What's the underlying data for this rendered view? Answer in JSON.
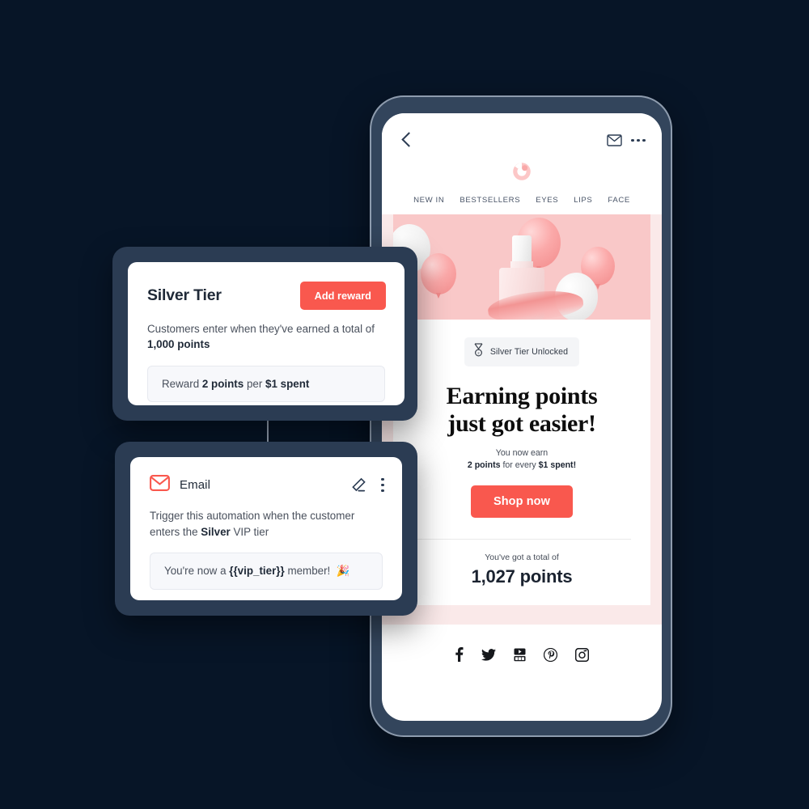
{
  "theme": {
    "background": "#071527",
    "frame": "#2b3c53",
    "accent": "#f9584e",
    "email_bg_pink": "#fae9e9",
    "hero_pink": "#f9c8c8"
  },
  "phone": {
    "topbar": {
      "back_icon": "chevron-left-icon",
      "envelope_icon": "envelope-icon",
      "more_icon": "more-horizontal-icon"
    },
    "brand_logo": "brand-swirl-logo",
    "categories": [
      "NEW IN",
      "BESTSELLERS",
      "EYES",
      "LIPS",
      "FACE"
    ],
    "email": {
      "hero_alt": "pink-and-white-balloons-with-perfume-bottle",
      "badge": {
        "icon": "medal-icon",
        "label": "Silver Tier Unlocked"
      },
      "headline_line1": "Earning points",
      "headline_line2": "just got easier!",
      "sub_line1": "You now earn",
      "sub_points": "2 points",
      "sub_mid": " for every ",
      "sub_spend": "$1 spent!",
      "cta_label": "Shop now",
      "total_label": "You've got a total of",
      "total_value": "1,027 points"
    },
    "social": [
      {
        "name": "facebook-icon",
        "label": "Facebook"
      },
      {
        "name": "twitter-icon",
        "label": "Twitter"
      },
      {
        "name": "youtube-icon",
        "label": "YouTube"
      },
      {
        "name": "pinterest-icon",
        "label": "Pinterest"
      },
      {
        "name": "instagram-icon",
        "label": "Instagram"
      }
    ]
  },
  "tier_card": {
    "title": "Silver Tier",
    "add_reward_label": "Add reward",
    "description_part1": "Customers enter when they've earned a total of ",
    "description_bold": "1,000 points",
    "reward_prefix": "Reward ",
    "reward_points": "2 points",
    "reward_mid": " per ",
    "reward_spend": "$1 spent"
  },
  "email_card": {
    "icon": "envelope-icon",
    "title": "Email",
    "edit_icon": "pencil-icon",
    "more_icon": "more-vertical-icon",
    "description_part1": "Trigger this automation when the customer enters the ",
    "description_bold": "Silver",
    "description_part2": " VIP tier",
    "message_prefix": "You're now a ",
    "message_variable": "{{vip_tier}}",
    "message_suffix": " member!",
    "message_emoji": "🎉"
  }
}
